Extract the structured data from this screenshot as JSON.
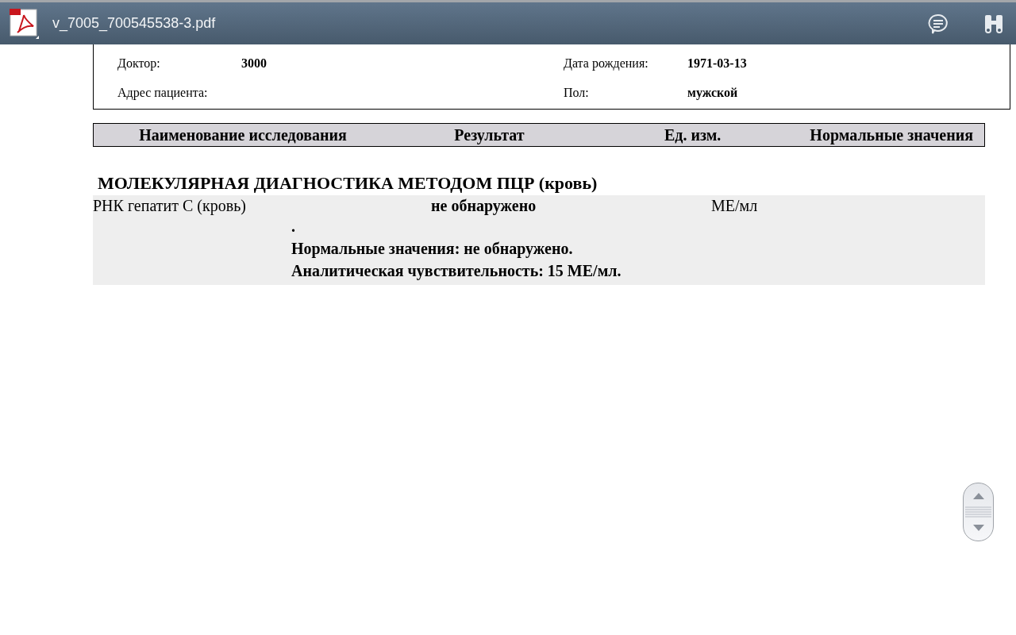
{
  "toolbar": {
    "file_name": "v_7005_700545538-3.pdf"
  },
  "patient_info": [
    {
      "label": "Доктор:",
      "value": "3000",
      "label_2": "Дата рождения:",
      "value_2": "1971-03-13"
    },
    {
      "label": "Адрес пациента:",
      "label_2": "Пол:",
      "value_2": "мужской"
    }
  ],
  "table": {
    "columns": [
      "Наименование исследования",
      "Результат",
      "Ед. изм.",
      "Нормальные значения"
    ],
    "section": "МОЛЕКУЛЯРНАЯ ДИАГНОСТИКА МЕТОДОМ ПЦР (кровь)",
    "rows": [
      {
        "test": "РНК гепатит С (кровь)",
        "result": "не обнаружено",
        "unit": "МЕ/мл",
        "notes": [
          ".",
          "Нормальные значения: не обнаружено.",
          "Аналитическая чувствительность: 15 МЕ/мл."
        ]
      }
    ]
  }
}
